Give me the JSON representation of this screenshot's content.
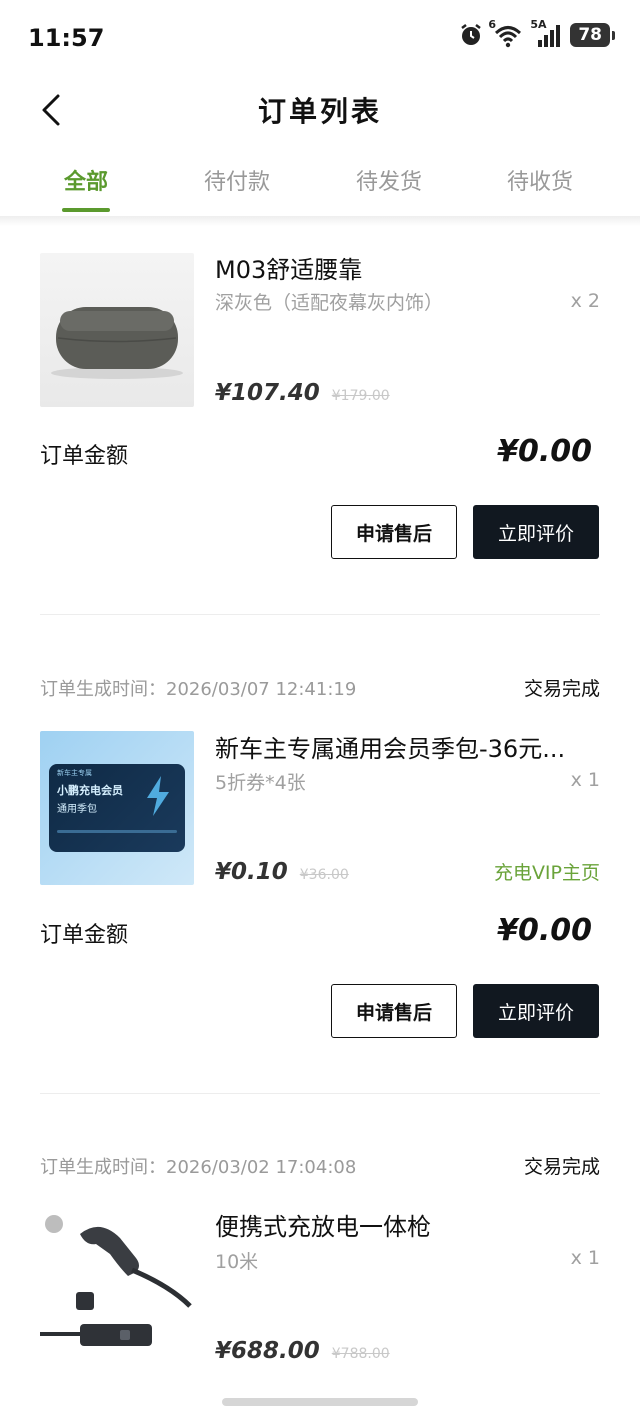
{
  "status_bar": {
    "time": "11:57",
    "network_label": "6",
    "signal_label": "5A",
    "battery": "78"
  },
  "header": {
    "title": "订单列表",
    "back_icon": "chevron-left-icon"
  },
  "tabs": [
    {
      "label": "全部",
      "active": true
    },
    {
      "label": "待付款",
      "active": false
    },
    {
      "label": "待发货",
      "active": false
    },
    {
      "label": "待收货",
      "active": false
    }
  ],
  "orders": [
    {
      "time_label": "",
      "status": "",
      "product": {
        "name": "M03舒适腰靠",
        "spec": "深灰色（适配夜幕灰内饰）",
        "qty": "x 2",
        "price": "¥107.40",
        "original_price": "¥179.00"
      },
      "total_label": "订单金额",
      "total_value": "¥0.00",
      "buttons": {
        "after_sale": "申请售后",
        "review": "立即评价"
      }
    },
    {
      "time_label": "订单生成时间：2026/03/07 12:41:19",
      "status": "交易完成",
      "product": {
        "name": "新车主专属通用会员季包-36元...",
        "spec": "5折券*4张",
        "qty": "x 1",
        "price": "¥0.10",
        "original_price": "¥36.00",
        "link": "充电VIP主页",
        "thumb_tag": "新车主专属",
        "thumb_title_1": "小鹏充电会员",
        "thumb_title_2": "通用季包"
      },
      "total_label": "订单金额",
      "total_value": "¥0.00",
      "buttons": {
        "after_sale": "申请售后",
        "review": "立即评价"
      }
    },
    {
      "time_label": "订单生成时间：2026/03/02 17:04:08",
      "status": "交易完成",
      "product": {
        "name": "便携式充放电一体枪",
        "spec": "10米",
        "qty": "x 1",
        "price": "¥688.00",
        "original_price": "¥788.00"
      }
    }
  ],
  "colors": {
    "accent": "#5b9a2e",
    "vip_link": "#6aa33a",
    "dark_button": "#111820"
  }
}
